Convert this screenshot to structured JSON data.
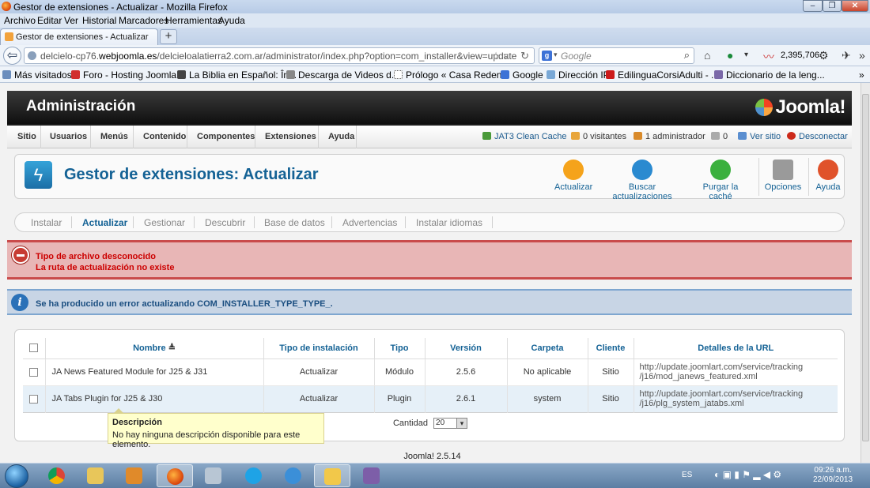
{
  "window": {
    "title": "Gestor de extensiones - Actualizar - Mozilla Firefox"
  },
  "menubar": [
    "Archivo",
    "Editar",
    "Ver",
    "Historial",
    "Marcadores",
    "Herramientas",
    "Ayuda"
  ],
  "tab": {
    "title": "Gestor de extensiones - Actualizar"
  },
  "nav": {
    "url_pre": "delcielo-cp76.",
    "url_domain": "webjoomla.es",
    "url_post": "/delcieloalatierra2.com.ar/administrator/index.php?option=com_installer&view=update",
    "search_placeholder": "Google",
    "counter": "2,395,706"
  },
  "bookmarks": [
    "Más visitados",
    "Foro - Hosting Joomla...",
    "La Biblia en Español: În...",
    "Descarga de Videos d...",
    "Prólogo « Casa Reden...",
    "Google",
    "Dirección IP",
    "EdilinguaCorsiAdulti - ...",
    "Diccionario de la leng..."
  ],
  "header": {
    "title": "Administración",
    "logo": "Joomla!"
  },
  "menu": [
    "Sitio",
    "Usuarios",
    "Menús",
    "Contenido",
    "Componentes",
    "Extensiones",
    "Ayuda"
  ],
  "status": {
    "cache": "JAT3 Clean Cache",
    "visitors": "0 visitantes",
    "admins": "1 administrador",
    "messages": "0",
    "view_site": "Ver sitio",
    "logout": "Desconectar"
  },
  "page_title": "Gestor de extensiones: Actualizar",
  "toolbar": [
    {
      "label": "Actualizar",
      "color": "#f5a31b"
    },
    {
      "label": "Buscar actualizaciones",
      "color": "#2a8ad0"
    },
    {
      "label": "Purgar la caché",
      "color": "#3bb03e"
    },
    {
      "label": "Opciones",
      "color": "#9a9a9a"
    },
    {
      "label": "Ayuda",
      "color": "#e0522a"
    }
  ],
  "subtabs": [
    "Instalar",
    "Actualizar",
    "Gestionar",
    "Descubrir",
    "Base de datos",
    "Advertencias",
    "Instalar idiomas"
  ],
  "errors": [
    "Tipo de archivo desconocido",
    "La ruta de actualización no existe"
  ],
  "info": "Se ha producido un error actualizando COM_INSTALLER_TYPE_TYPE_.",
  "table": {
    "headers": [
      "Nombre",
      "Tipo de instalación",
      "Tipo",
      "Versión",
      "Carpeta",
      "Cliente",
      "Detalles de la URL"
    ],
    "rows": [
      {
        "name": "JA News Featured Module for J25 & J31",
        "install": "Actualizar",
        "type": "Módulo",
        "version": "2.5.6",
        "folder": "No aplicable",
        "client": "Sitio",
        "url1": "http://update.joomlart.com/service/tracking",
        "url2": "/j16/mod_janews_featured.xml"
      },
      {
        "name": "JA Tabs Plugin for J25 & J30",
        "install": "Actualizar",
        "type": "Plugin",
        "version": "2.6.1",
        "folder": "system",
        "client": "Sitio",
        "url1": "http://update.joomlart.com/service/tracking",
        "url2": "/j16/plg_system_jatabs.xml"
      }
    ],
    "limit_label": "Cantidad",
    "limit_value": "20"
  },
  "tooltip": {
    "title": "Descripción",
    "body": "No hay ninguna descripción disponible para este elemento."
  },
  "footer": "Joomla! 2.5.14",
  "taskbar": {
    "lang": "ES",
    "time": "09:26 a.m.",
    "date": "22/09/2013"
  }
}
